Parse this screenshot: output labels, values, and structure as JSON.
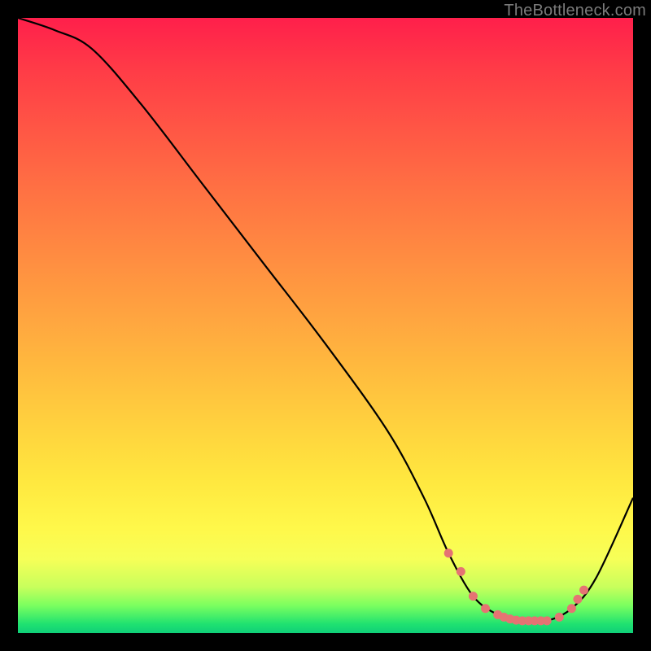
{
  "watermark": "TheBottleneck.com",
  "chart_data": {
    "type": "line",
    "title": "",
    "xlabel": "",
    "ylabel": "",
    "xlim": [
      0,
      100
    ],
    "ylim": [
      0,
      100
    ],
    "grid": false,
    "legend": false,
    "series": [
      {
        "name": "bottleneck-curve",
        "x": [
          0,
          6,
          12,
          20,
          30,
          40,
          50,
          60,
          66,
          70,
          74,
          78,
          82,
          86,
          90,
          94,
          100
        ],
        "values": [
          100,
          98,
          95,
          86,
          73,
          60,
          47,
          33,
          22,
          13,
          6,
          3,
          2,
          2,
          4,
          9,
          22
        ]
      }
    ],
    "markers": {
      "name": "optimal-range",
      "x": [
        70,
        72,
        74,
        76,
        78,
        79,
        80,
        81,
        82,
        83,
        84,
        85,
        86,
        88,
        90,
        91,
        92
      ],
      "values": [
        13,
        10,
        6,
        4,
        3,
        2.6,
        2.3,
        2.1,
        2,
        2,
        2,
        2,
        2,
        2.6,
        4,
        5.5,
        7
      ]
    }
  }
}
